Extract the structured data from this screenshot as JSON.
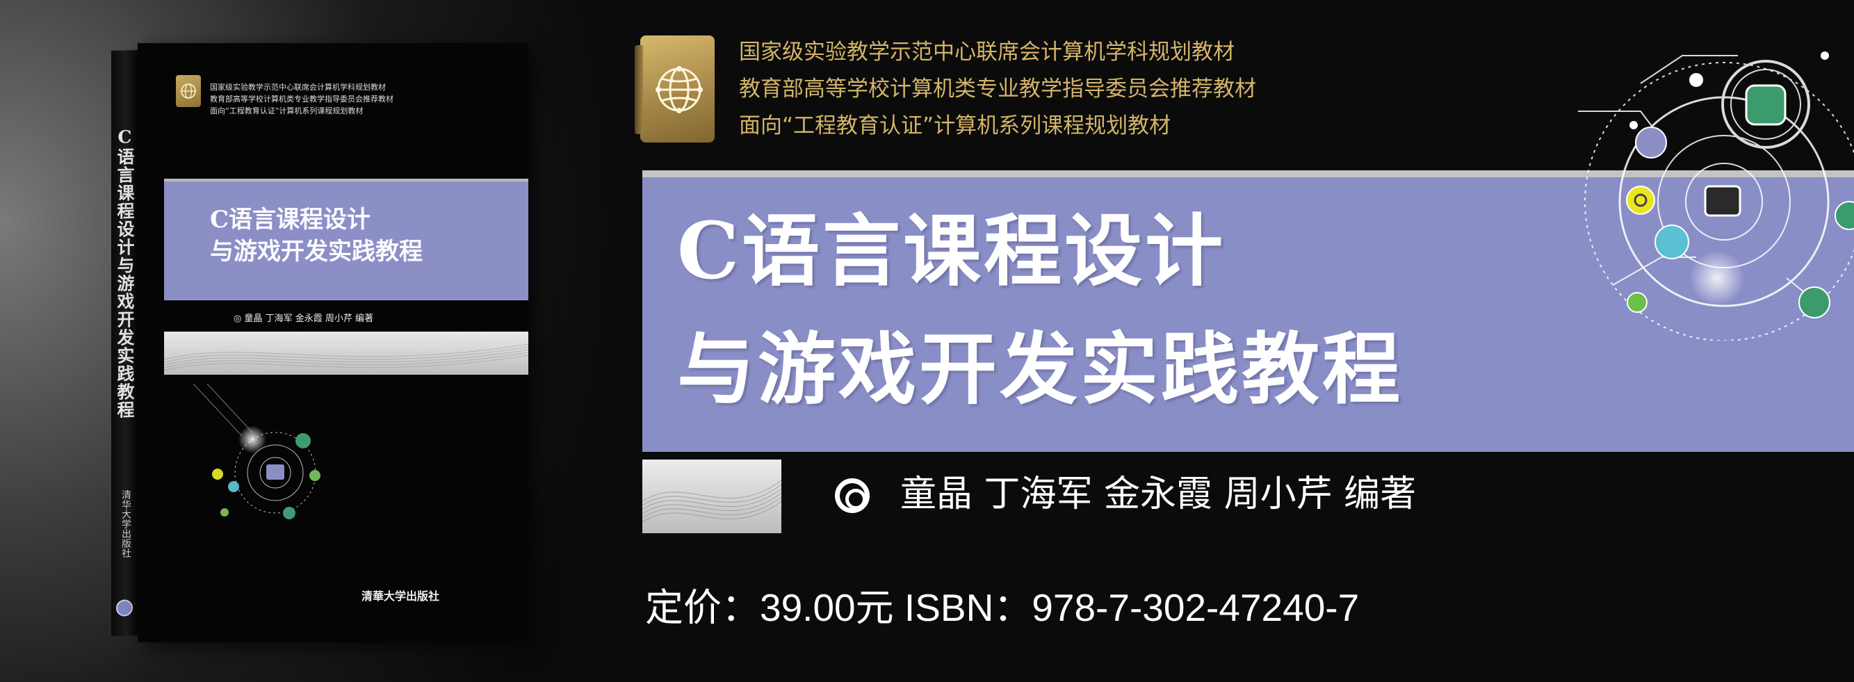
{
  "book": {
    "series_lines": [
      "国家级实验教学示范中心联席会计算机学科规划教材",
      "教育部高等学校计算机类专业教学指导委员会推荐教材",
      "面向“工程教育认证”计算机系列课程规划教材"
    ],
    "title_line1": "C语言课程设计",
    "title_line2": "与游戏开发实践教程",
    "authors": "◎ 童晶  丁海军  金永霞  周小芹    编著",
    "spine_title": "C语言课程设计与游戏开发实践教程",
    "spine_publisher": "清华大学出版社",
    "publisher": "清華大学出版社"
  },
  "banner": {
    "series_lines": [
      "国家级实验教学示范中心联席会计算机学科规划教材",
      "教育部高等学校计算机类专业教学指导委员会推荐教材",
      "面向“工程教育认证”计算机系列课程规划教材"
    ],
    "title_line1": "C语言课程设计",
    "title_line2": "与游戏开发实践教程",
    "authors": "童晶  丁海军  金永霞  周小芹    编著",
    "price_line": "定价：39.00元    ISBN：978-7-302-47240-7"
  },
  "icons": {
    "series_logo": "globe-book-icon",
    "author_marker": "target-icon",
    "tech_graphic": "network-circuit-icons"
  },
  "colors": {
    "title_band": "#8a8ec7",
    "gold_text": "#d3b468",
    "background": "#0b0b0b"
  }
}
